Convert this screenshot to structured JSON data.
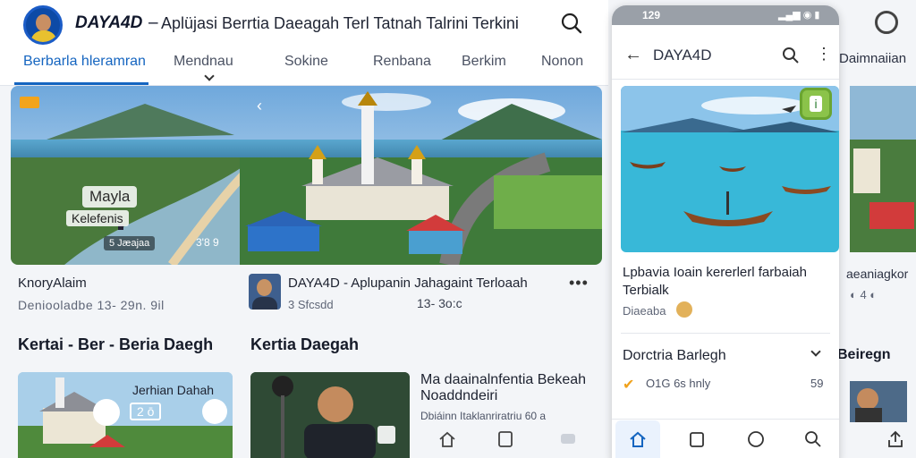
{
  "header": {
    "brand": "DAYA4D",
    "separator": "–",
    "subtitle": "Aplüjasi Berrtia Daeagah Terl Tatnah Talrini Terkini",
    "tabs": [
      {
        "label": "Berbarla hleramran",
        "active": true
      },
      {
        "label": "Mendnau",
        "active": false
      },
      {
        "label": "Sokine",
        "active": false
      },
      {
        "label": "Renbana",
        "active": false
      },
      {
        "label": "Berkim",
        "active": false
      },
      {
        "label": "Nonon",
        "active": false
      }
    ]
  },
  "hero": {
    "overlay_title": "Mayla",
    "overlay_sub": "Kelefenis",
    "chip": "5 Jæajaa",
    "count": "3'8 9"
  },
  "hero_caption": "KnoryAlaim",
  "hero_meta": "Deniooladbe   13- 29n. 9il",
  "author": {
    "title": "DAYA4D - Aplupanin Jahagaint Terloaah",
    "meta": "3 Sfcsdd",
    "stats": "13- 3o:c"
  },
  "sections": {
    "left": "Kertai - Ber - Beria Daegh",
    "right": "Kertia Daegah"
  },
  "card1": {
    "label": "Jerhian Dahah",
    "timer": "2 ō"
  },
  "card2": {
    "title": "Ma daainalnfentia Bekeah Noaddndeiri",
    "meta": "Dbiáinn Itaklanriratriu 60 a"
  },
  "phone": {
    "status_time": "129",
    "status_icons": "▂▄▆ ◉ ▮",
    "title": "DAYA4D",
    "headline": "Lpbavia Ioain kererlerl farbaiah Terbialk",
    "source": "Diaeaba",
    "section": "Dorctria Barlegh",
    "like_text": "O1G 6s hnly",
    "side": "59",
    "badge_glyph": "i"
  },
  "peek": {
    "title": "Daimnaiian",
    "caption": "aeaniagkor",
    "meta": "◐ 4 ◐",
    "section": "Beiregn"
  },
  "colors": {
    "accent": "#1565c0",
    "badge": "#8bc34a",
    "hero_tag": "#f2a41c"
  },
  "icons": [
    "search-icon",
    "chevron-down-icon",
    "back-arrow-icon",
    "more-vert-icon",
    "home-icon",
    "bookmark-icon",
    "explore-icon",
    "share-icon",
    "bell-icon",
    "like-icon",
    "calendar-icon",
    "comment-icon"
  ]
}
